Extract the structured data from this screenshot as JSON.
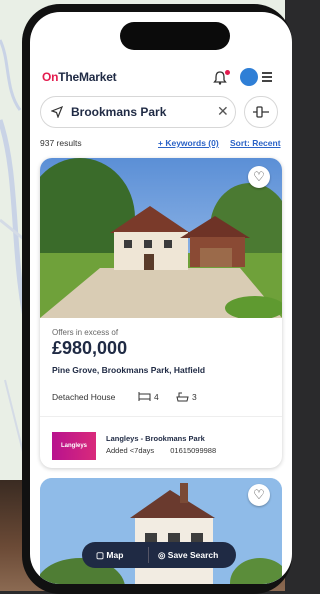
{
  "header": {
    "logo_pre": "On",
    "logo_rest": "TheMarket"
  },
  "search": {
    "query": "Brookmans Park"
  },
  "results_bar": {
    "results": "937 results",
    "keywords": "+ Keywords (0)",
    "sort": "Sort: Recent"
  },
  "listing": {
    "offers": "Offers in excess of",
    "price": "£980,000",
    "address": "Pine Grove, Brookmans Park, Hatfield",
    "type": "Detached House",
    "beds": "4",
    "baths": "3",
    "agent_logo": "Langleys",
    "agent_name": "Langleys - Brookmans Park",
    "added": "Added <7days",
    "phone": "01615099988"
  },
  "bottom_bar": {
    "map": "Map",
    "save_search": "Save Search"
  },
  "colors": {
    "brand": "#e31b4e",
    "navy": "#1f2a44",
    "link": "#2b63c7"
  }
}
